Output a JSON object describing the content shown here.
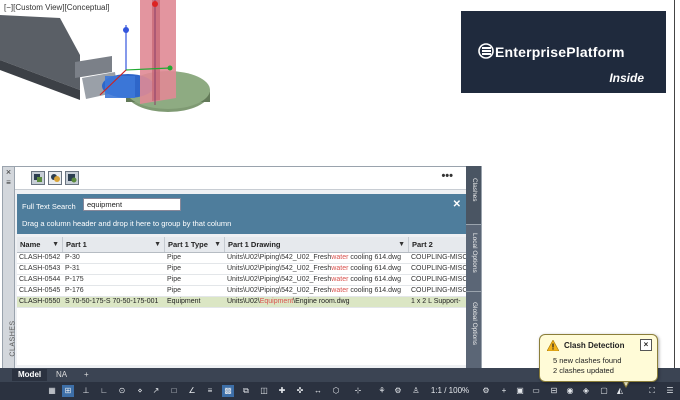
{
  "viewport": {
    "view_label": "[−][Custom View][Conceptual]"
  },
  "banner": {
    "title": "EnterprisePlatform",
    "subtitle": "Inside",
    "background": "#1f2a3d"
  },
  "palette": {
    "title": "CLASHES",
    "close_icon": "×",
    "more_label": "•••",
    "search_label": "Full Text Search",
    "search_value": "equipment",
    "group_hint": "Drag a column header and drop it here to group by that column",
    "columns": [
      "Name",
      "Part 1",
      "Part 1 Type",
      "Part 1 Drawing",
      "Part 2"
    ],
    "rows": [
      {
        "name": "CLASH-0542",
        "part1": "P-30",
        "type": "Pipe",
        "drawing_prefix": "Units\\U02\\Piping\\542_U02_Fresh",
        "drawing_hl": "water",
        "drawing_suffix": " cooling 614.dwg",
        "part2": "COUPLING-MISC"
      },
      {
        "name": "CLASH-0543",
        "part1": "P-31",
        "type": "Pipe",
        "drawing_prefix": "Units\\U02\\Piping\\542_U02_Fresh",
        "drawing_hl": "water",
        "drawing_suffix": " cooling 614.dwg",
        "part2": "COUPLING-MISC"
      },
      {
        "name": "CLASH-0544",
        "part1": "P-175",
        "type": "Pipe",
        "drawing_prefix": "Units\\U02\\Piping\\542_U02_Fresh",
        "drawing_hl": "water",
        "drawing_suffix": " cooling 614.dwg",
        "part2": "COUPLING-MISC"
      },
      {
        "name": "CLASH-0545",
        "part1": "P-176",
        "type": "Pipe",
        "drawing_prefix": "Units\\U02\\Piping\\542_U02_Fresh",
        "drawing_hl": "water",
        "drawing_suffix": " cooling 614.dwg",
        "part2": "COUPLING-MISC"
      },
      {
        "name": "CLASH-0550",
        "part1": "S 70-50-175-S 70-50-175-001",
        "type": "Equipment",
        "drawing_prefix": "Units\\U02\\",
        "drawing_hl": "Equipment",
        "drawing_suffix": "\\Engine room.dwg",
        "part2": "1 x 2 L Support-"
      }
    ],
    "side_tabs": [
      "Clashes",
      "Local Options",
      "Global Options"
    ]
  },
  "tabbar": {
    "tabs": [
      "Model",
      "NA",
      "+"
    ]
  },
  "statusbar": {
    "scale_label": "1:1 / 100%"
  },
  "popup": {
    "title": "Clash Detection",
    "line1": "5 new clashes found",
    "line2": "2 clashes updated",
    "close_label": "×"
  },
  "colors": {
    "accent": "#4e7d9c",
    "selected_row": "#dbe6c4",
    "highlight": "#d9534f",
    "popup_bg": "#fffbd7"
  }
}
